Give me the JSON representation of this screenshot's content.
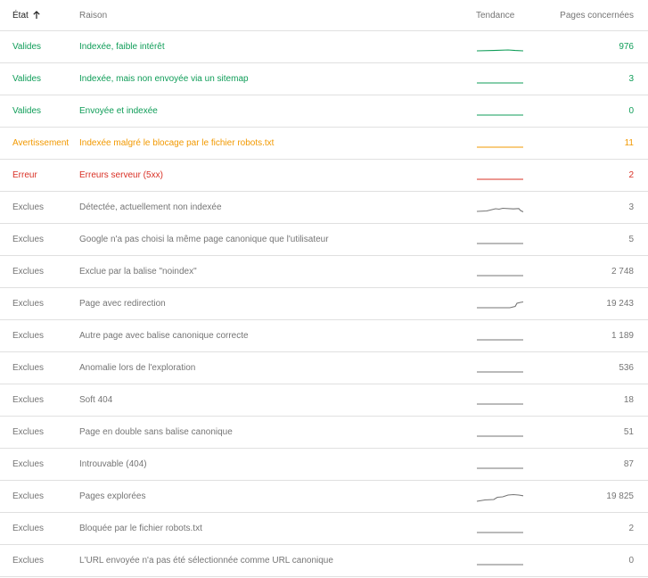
{
  "header": {
    "state": "État",
    "reason": "Raison",
    "trend": "Tendance",
    "pages": "Pages concernées"
  },
  "colors": {
    "valid": "#0f9d58",
    "warning": "#f29900",
    "error": "#d93025",
    "excluded": "#757575"
  },
  "rows": [
    {
      "state": "Valides",
      "reason": "Indexée, faible intérêt",
      "pages": "976",
      "status": "valid",
      "trend": "slight-rise"
    },
    {
      "state": "Valides",
      "reason": "Indexée, mais non envoyée via un sitemap",
      "pages": "3",
      "status": "valid",
      "trend": "flat"
    },
    {
      "state": "Valides",
      "reason": "Envoyée et indexée",
      "pages": "0",
      "status": "valid",
      "trend": "flat"
    },
    {
      "state": "Avertissement",
      "reason": "Indexée malgré le blocage par le fichier robots.txt",
      "pages": "11",
      "status": "warning",
      "trend": "flat"
    },
    {
      "state": "Erreur",
      "reason": "Erreurs serveur (5xx)",
      "pages": "2",
      "status": "error",
      "trend": "flat"
    },
    {
      "state": "Exclues",
      "reason": "Détectée, actuellement non indexée",
      "pages": "3",
      "status": "excluded",
      "trend": "bump"
    },
    {
      "state": "Exclues",
      "reason": "Google n'a pas choisi la même page canonique que l'utilisateur",
      "pages": "5",
      "status": "excluded",
      "trend": "flat"
    },
    {
      "state": "Exclues",
      "reason": "Exclue par la balise \"noindex\"",
      "pages": "2 748",
      "status": "excluded",
      "trend": "flat"
    },
    {
      "state": "Exclues",
      "reason": "Page avec redirection",
      "pages": "19 243",
      "status": "excluded",
      "trend": "end-rise"
    },
    {
      "state": "Exclues",
      "reason": "Autre page avec balise canonique correcte",
      "pages": "1 189",
      "status": "excluded",
      "trend": "flat"
    },
    {
      "state": "Exclues",
      "reason": "Anomalie lors de l'exploration",
      "pages": "536",
      "status": "excluded",
      "trend": "flat"
    },
    {
      "state": "Exclues",
      "reason": "Soft 404",
      "pages": "18",
      "status": "excluded",
      "trend": "flat"
    },
    {
      "state": "Exclues",
      "reason": "Page en double sans balise canonique",
      "pages": "51",
      "status": "excluded",
      "trend": "flat"
    },
    {
      "state": "Exclues",
      "reason": "Introuvable (404)",
      "pages": "87",
      "status": "excluded",
      "trend": "flat"
    },
    {
      "state": "Exclues",
      "reason": "Pages explorées",
      "pages": "19 825",
      "status": "excluded",
      "trend": "rise"
    },
    {
      "state": "Exclues",
      "reason": "Bloquée par le fichier robots.txt",
      "pages": "2",
      "status": "excluded",
      "trend": "flat"
    },
    {
      "state": "Exclues",
      "reason": "L'URL envoyée n'a pas été sélectionnée comme URL canonique",
      "pages": "0",
      "status": "excluded",
      "trend": "flat"
    }
  ]
}
